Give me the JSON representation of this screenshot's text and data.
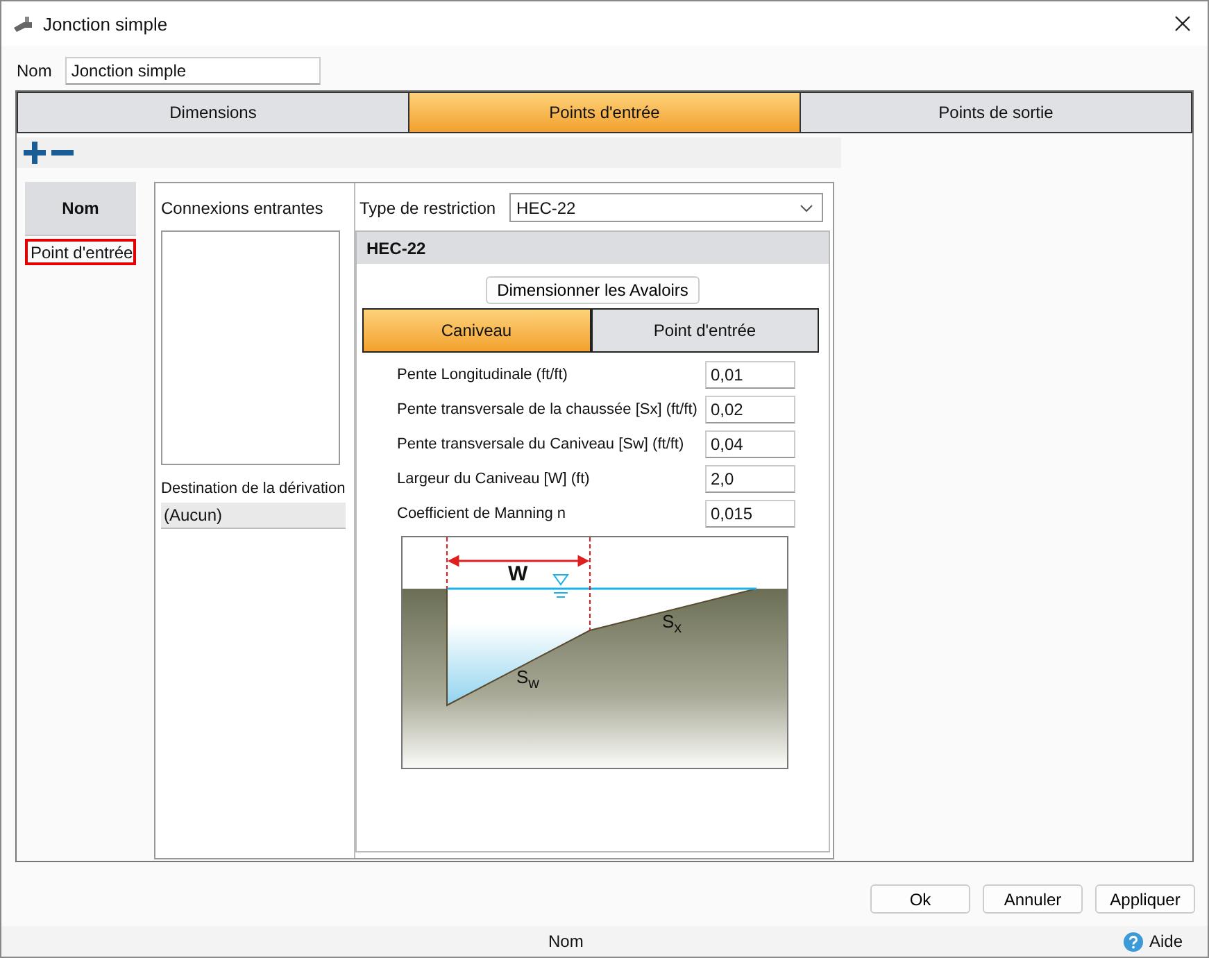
{
  "window": {
    "title": "Jonction simple"
  },
  "name_field": {
    "label": "Nom",
    "value": "Jonction simple"
  },
  "tabs": [
    {
      "label": "Dimensions",
      "selected": false
    },
    {
      "label": "Points d'entrée",
      "selected": true
    },
    {
      "label": "Points de sortie",
      "selected": false
    }
  ],
  "list": {
    "header": "Nom",
    "items": [
      {
        "label": "Point d'entrée",
        "selected": true
      }
    ]
  },
  "incoming": {
    "label": "Connexions entrantes"
  },
  "bypass": {
    "label": "Destination de la dérivation",
    "value": "(Aucun)"
  },
  "restriction": {
    "label": "Type de restriction",
    "value": "HEC-22"
  },
  "group": {
    "title": "HEC-22",
    "button": "Dimensionner les Avaloirs",
    "subtabs": [
      {
        "label": "Caniveau",
        "selected": true
      },
      {
        "label": "Point d'entrée",
        "selected": false
      }
    ],
    "fields": [
      {
        "label": "Pente Longitudinale (ft/ft)",
        "value": "0,01"
      },
      {
        "label": "Pente transversale de la chaussée [Sx] (ft/ft)",
        "value": "0,02"
      },
      {
        "label": "Pente transversale du Caniveau [Sw] (ft/ft)",
        "value": "0,04"
      },
      {
        "label": "Largeur du Caniveau [W] (ft)",
        "value": "2,0"
      },
      {
        "label": "Coefficient de Manning n",
        "value": "0,015"
      }
    ],
    "diagram": {
      "width_label": "W",
      "sw_label": "S$_{w}$",
      "sx_label": "S$_{x}$"
    }
  },
  "buttons": [
    "Ok",
    "Annuler",
    "Appliquer"
  ],
  "status_bar": {
    "text": "Nom",
    "help": "Aide"
  }
}
